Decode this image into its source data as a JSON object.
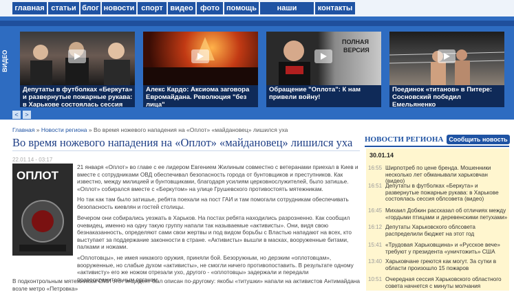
{
  "nav": {
    "items": [
      "главная",
      "статьи",
      "блог",
      "новости",
      "спорт",
      "видео",
      "фото",
      "помощь",
      "наши проекты",
      "контакты"
    ]
  },
  "video": {
    "label": "ВИДЕО",
    "cards": [
      {
        "caption": "Депутаты в футболках «Беркута» и развернутые пожарные рукава: в Харькове состоялась сессия облсовета"
      },
      {
        "caption": "Алекс Кардо: Аксиома заговора Евромайдана. Революция \"без лица\"",
        "overlay": "Алекс Кардо: Аксиома заговора Евромайдана. Революция без лица"
      },
      {
        "caption": "Обращение \"Оплота\": К нам привели войну!",
        "overlay": "ПОЛНАЯ ВЕРСИЯ"
      },
      {
        "caption": "Поединок «титанов» в Питере: Сосновский победил Емельяненко"
      }
    ],
    "prev": "<",
    "next": ">"
  },
  "breadcrumb": {
    "home": "Главная",
    "section": "Новости региона",
    "sep": " » ",
    "current": "Во время ножевого нападения на «Оплот» «майдановец» лишился уха"
  },
  "article": {
    "title": "Во время ножевого нападения на «Оплот» «майдановец» лишился уха",
    "date": "22.01.14 - 03:17",
    "photo_text": "ОПЛОТ",
    "p1": "21 января «Оплот» во главе с ее лидером Евгением Жилиным совместно с ветеранами приехал в Киев и вместе с сотрудниками ОВД обеспечивал безопасность города от бунтовщиков и преступников. Как известно, между милицией и бунтовщиками, благодаря усилиям церковнослужителей, было затишье. «Оплот» собирался вместе с «Беркутом» на улице Грушевского противостоять мятежникам.",
    "p2": "Но так как там было затишье, ребята поехали на пост ГАИ и там помогали сотрудникам обеспечивать безопасность киевлян и гостей столицы.",
    "p3": "Вечером они собирались уезжать в Харьков. На постах ребята находились разрозненно. Как сообщил очевидец, именно на одну такую группу напали так называемые «активисты». Они, видя свою безнаказанность, определяют сами свои жертвы и под видом борьбы с Властью нападают на всех, кто выступает за поддержание законности в стране. «Активисты» вышли в масках, вооруженные битами, палками и ножами.",
    "p4": "«Оплотовцы», не имея никакого оружия, приняли бой. Безоружным, но дерзким «оплотовцам», вооруженные, но слабые духом «активисты», не смогли ничего противопоставить. В результате одному «активисту» его же ножом отрезали ухо, другого - «оплотовцы» задержали и передали правоохранительным органам.",
    "p5": "В подконтрольным мятежникам СМИ этот инцидент был описан по-другому: якобы «титушки» напали на активистов Антимайдана возле метро «Петровка»"
  },
  "sidebar": {
    "heading": "НОВОСТИ РЕГИОНА",
    "subscribe": "Сообщить новость",
    "date": "30.01.14",
    "items": [
      {
        "time": "16:55",
        "text": "Ширпотреб по цене бренда. Мошенники несколько лет обманывали харьковчан (видео)"
      },
      {
        "time": "16:51",
        "text": "Депутаты в футболках «Беркута» и развернутые пожарные рукава: в Харькове состоялась сессия облсовета (видео)"
      },
      {
        "time": "16:45",
        "text": "Михаил Добкин рассказал об отличиях между «гордыми птицами и деревенскими петухами»"
      },
      {
        "time": "16:12",
        "text": "Депутаты Харьковского облсовета распределили бюджет на этот год"
      },
      {
        "time": "15:41",
        "text": "«Трудовая Харьковщина» и «Русское вече» требуют у президента «уничтожить» США"
      },
      {
        "time": "13:40",
        "text": "Харьковчане греются как могут. За сутки в области произошло 15 пожаров"
      },
      {
        "time": "10:51",
        "text": "Очередная сессия Харьковского областного совета начнется с минуты молчания"
      }
    ]
  }
}
